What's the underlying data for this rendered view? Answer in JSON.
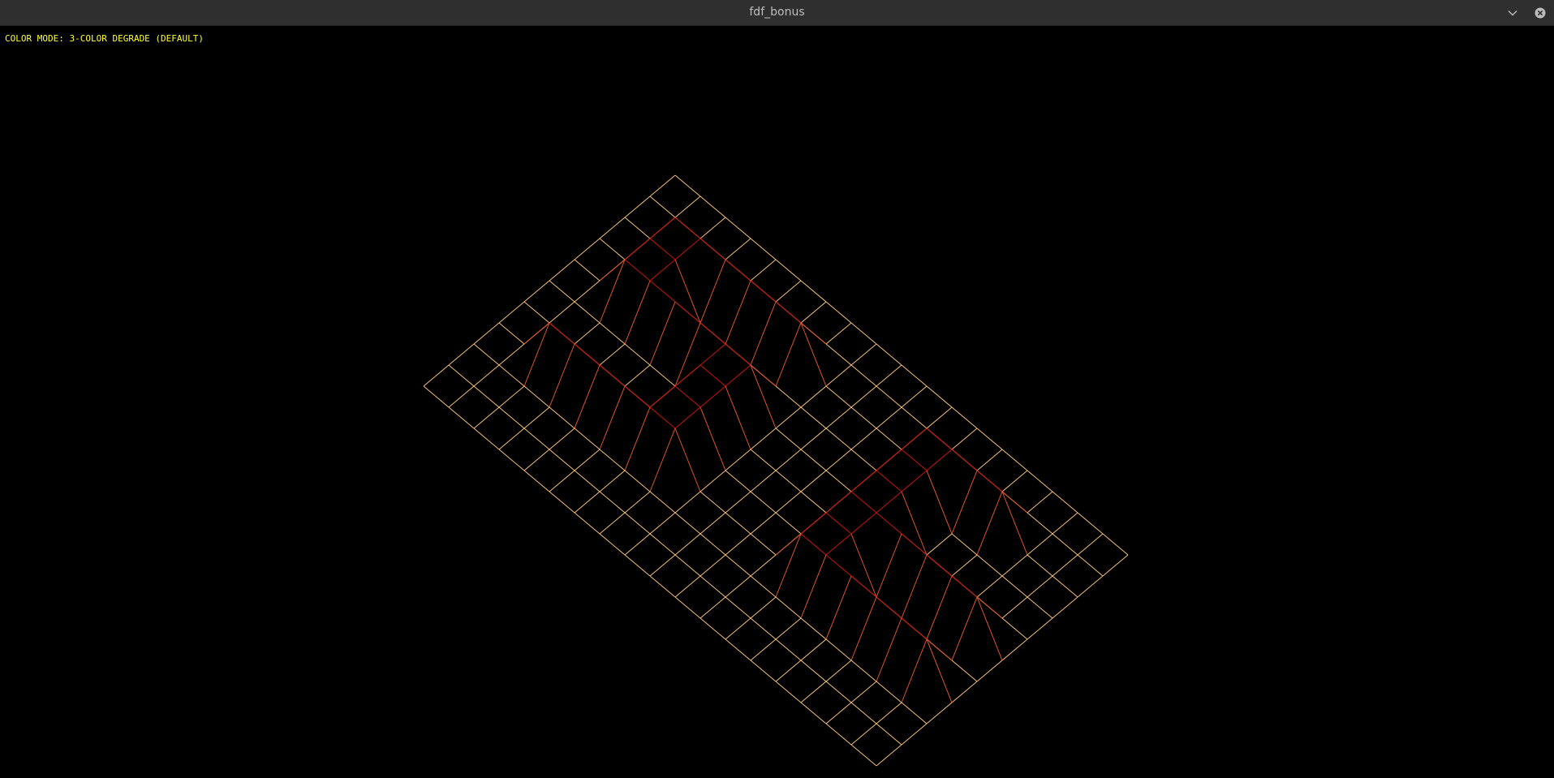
{
  "window": {
    "title": "fdf_bonus",
    "controls": {
      "minimize_icon": "chevron-down-icon",
      "close_icon": "close-icon"
    }
  },
  "overlay": {
    "color_mode_label": "COLOR MODE: 3-COLOR DEGRADE (DEFAULT)"
  },
  "colors": {
    "background": "#000000",
    "titlebar": "#2f2f2f",
    "label_text": "#ffff2a",
    "wire_low": "#f5c27a",
    "wire_mid": "#e2552a",
    "wire_high": "#c8140c"
  },
  "heightmap": [
    [
      0,
      0,
      0,
      0,
      0,
      0,
      0,
      0,
      0,
      0,
      0,
      0,
      0,
      0,
      0,
      0,
      0,
      0,
      0
    ],
    [
      0,
      0,
      0,
      0,
      0,
      0,
      0,
      0,
      0,
      0,
      0,
      0,
      0,
      0,
      0,
      0,
      0,
      0,
      0
    ],
    [
      0,
      0,
      10,
      10,
      10,
      10,
      10,
      10,
      0,
      0,
      0,
      0,
      10,
      10,
      10,
      10,
      0,
      0,
      0
    ],
    [
      0,
      0,
      10,
      10,
      0,
      0,
      0,
      0,
      0,
      0,
      0,
      0,
      10,
      10,
      0,
      0,
      0,
      0,
      0
    ],
    [
      0,
      0,
      10,
      10,
      10,
      10,
      10,
      10,
      0,
      0,
      0,
      0,
      10,
      10,
      0,
      0,
      0,
      0,
      0
    ],
    [
      0,
      0,
      0,
      0,
      0,
      0,
      10,
      10,
      0,
      0,
      0,
      0,
      10,
      10,
      10,
      10,
      10,
      10,
      0
    ],
    [
      0,
      0,
      0,
      0,
      0,
      0,
      10,
      10,
      0,
      0,
      0,
      0,
      10,
      10,
      0,
      0,
      0,
      0,
      0
    ],
    [
      0,
      0,
      10,
      10,
      10,
      10,
      10,
      10,
      0,
      0,
      0,
      0,
      10,
      10,
      10,
      10,
      10,
      10,
      0
    ],
    [
      0,
      0,
      0,
      0,
      0,
      0,
      0,
      0,
      0,
      0,
      0,
      0,
      0,
      0,
      0,
      0,
      0,
      0,
      0
    ],
    [
      0,
      0,
      0,
      0,
      0,
      0,
      0,
      0,
      0,
      0,
      0,
      0,
      0,
      0,
      0,
      0,
      0,
      0,
      0
    ],
    [
      0,
      0,
      0,
      0,
      0,
      0,
      0,
      0,
      0,
      0,
      0,
      0,
      0,
      0,
      0,
      0,
      0,
      0,
      0
    ]
  ]
}
